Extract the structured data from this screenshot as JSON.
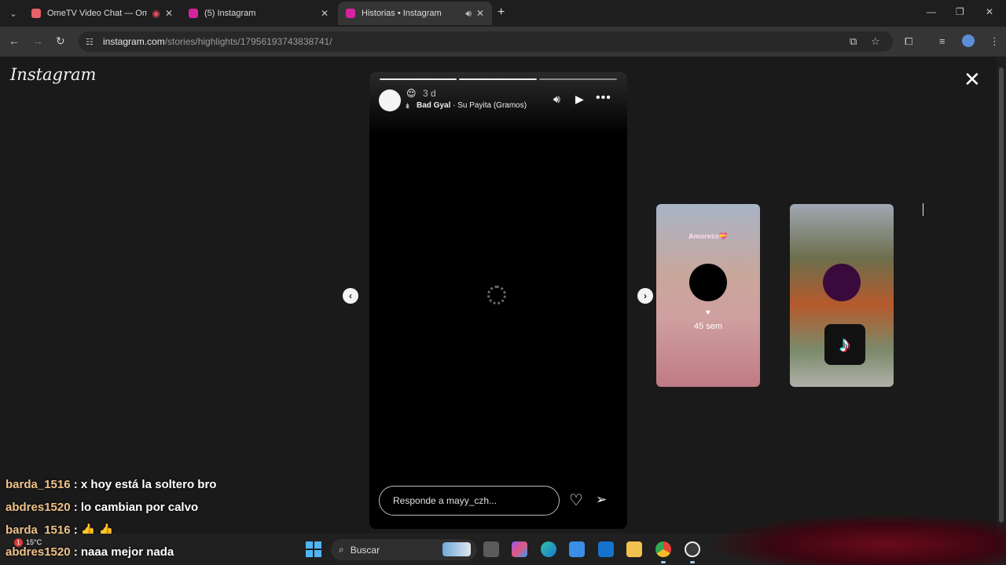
{
  "browser": {
    "tabs": [
      {
        "title": "OmeTV Video Chat — Ome",
        "favicon_color": "#e8616a"
      },
      {
        "title": "(5) Instagram",
        "favicon_color": "#d6249f"
      },
      {
        "title": "Historias • Instagram",
        "favicon_color": "#d6249f"
      }
    ],
    "url_host": "instagram.com",
    "url_path": "/stories/highlights/17956193743838741/"
  },
  "page": {
    "logo": "Instagram",
    "story": {
      "emoji": "😌",
      "age": "3 d",
      "music_artist": "Bad Gyal",
      "music_sep": " · ",
      "music_track": "Su Payita (Gramos)",
      "reply_placeholder": "Responde a mayy_czh...",
      "progress_segments": 3,
      "progress_completed": 2
    },
    "next_previews": [
      {
        "label": "Amoress💝",
        "time": "45 sem"
      },
      {
        "label": ""
      }
    ]
  },
  "chat": [
    {
      "user": "barda_1516",
      "message": " : x hoy está la soltero bro"
    },
    {
      "user": "abdres1520",
      "message": " : lo cambian por calvo"
    },
    {
      "user": "barda_1516",
      "message": " : 👍 👍"
    },
    {
      "user": "abdres1520",
      "message": " : naaa mejor nada"
    }
  ],
  "taskbar": {
    "weather_badge": "1",
    "weather_temp": "15°C",
    "search_label": "Buscar"
  }
}
